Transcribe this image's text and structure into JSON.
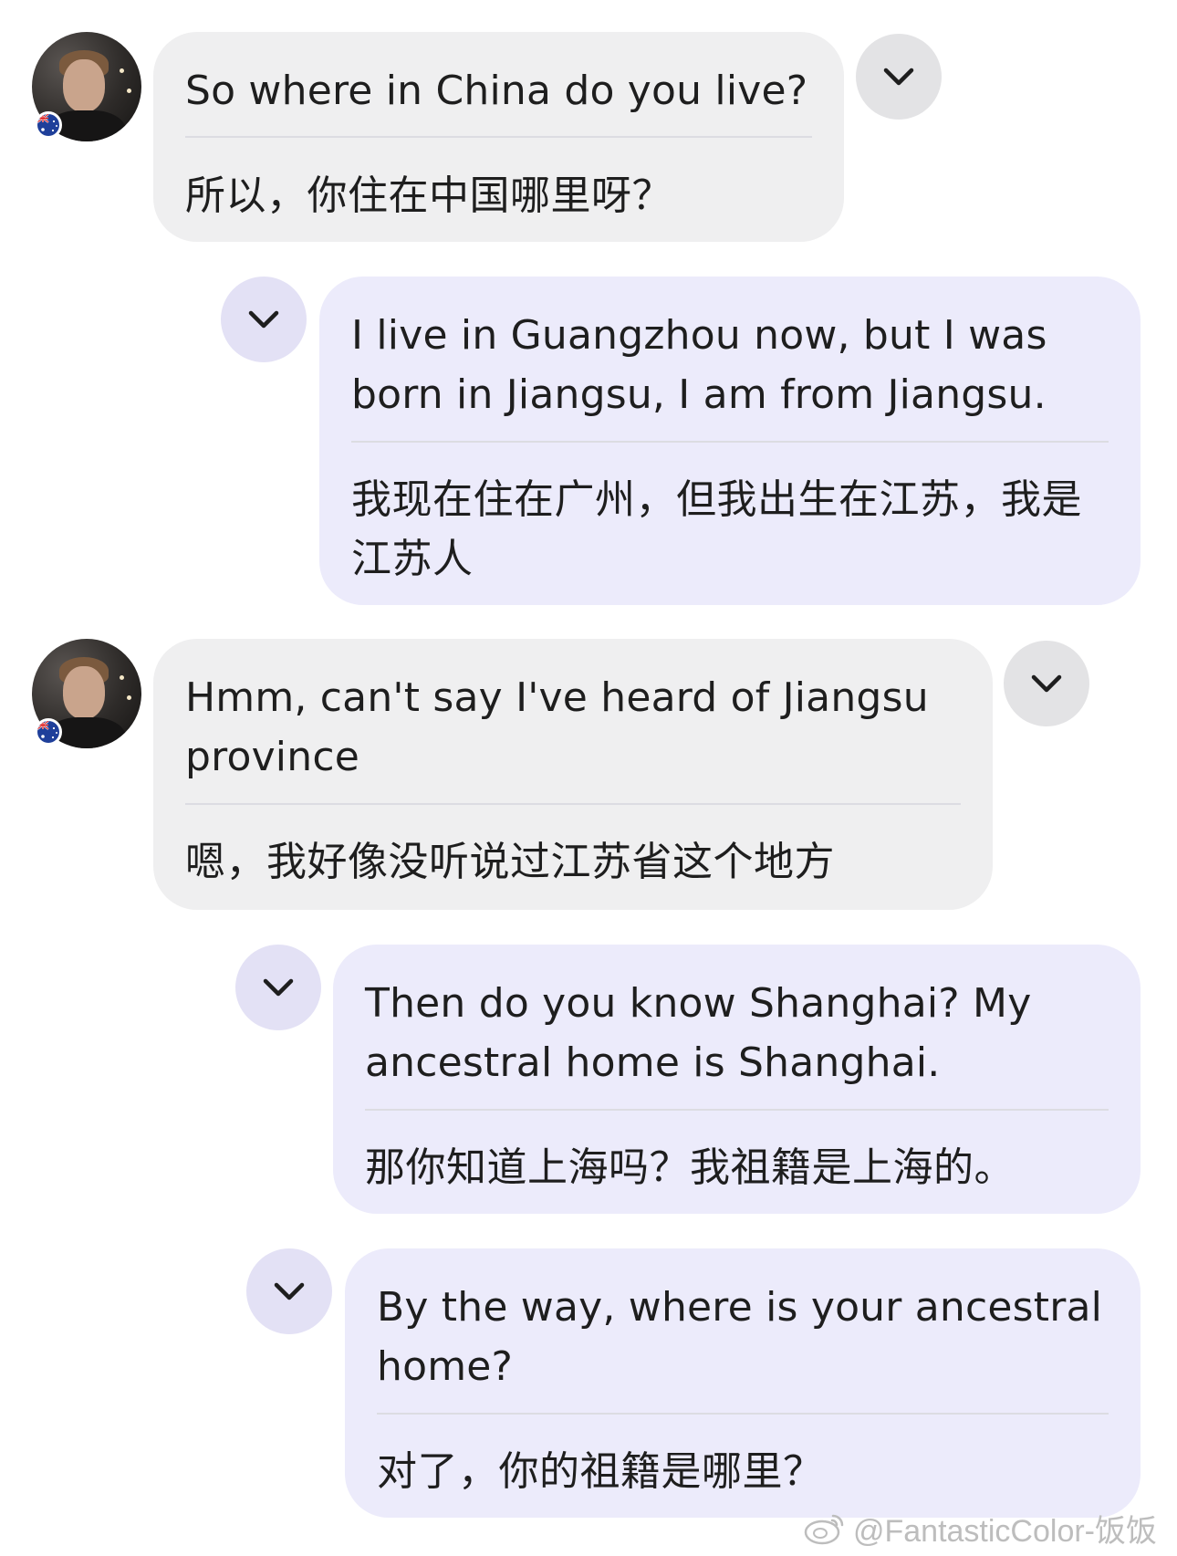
{
  "messages": [
    {
      "side": "in",
      "en": "So where in China do you live?",
      "zh": "所以，你住在中国哪里呀？"
    },
    {
      "side": "out",
      "en": "I live in Guangzhou now, but I was born in Jiangsu, I am from Jiangsu.",
      "zh": " 我现在住在广州，但我出生在江苏，我是江苏人"
    },
    {
      "side": "in",
      "en": "Hmm, can't say I've heard of Jiangsu province",
      "zh": "嗯，我好像没听说过江苏省这个地方"
    },
    {
      "side": "out",
      "en": "Then do you know Shanghai? My ancestral home is Shanghai.",
      "zh": "那你知道上海吗？我祖籍是上海的。"
    },
    {
      "side": "out",
      "en": "By the way, where is your ancestral home?",
      "zh": "对了，你的祖籍是哪里？"
    }
  ],
  "icons": {
    "expand": "chevron-down-icon",
    "flag": "australia-flag-icon",
    "watermark": "weibo-icon"
  },
  "watermark": {
    "text": "@FantasticColor-饭饭"
  },
  "colors": {
    "incoming_bubble": "#efeff0",
    "outgoing_bubble": "#ecebfb",
    "incoming_chevron": "#e3e3e5",
    "outgoing_chevron": "#e3e1f5",
    "text": "#1e1e1e"
  }
}
